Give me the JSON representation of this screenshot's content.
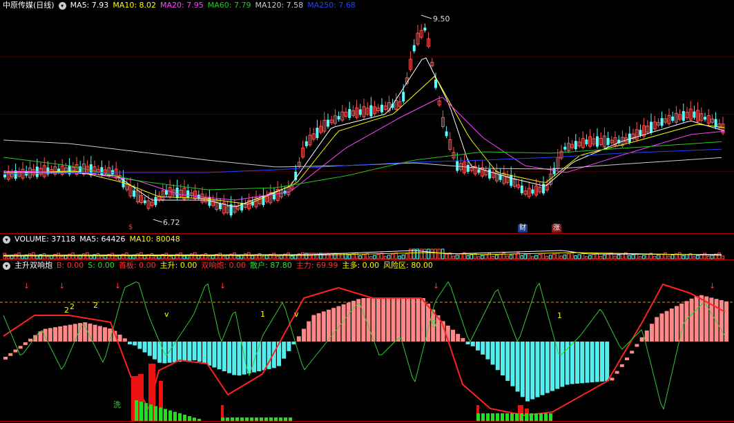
{
  "main": {
    "title": "中原传媒(日线)",
    "ma": [
      {
        "label": "MA5: 7.93",
        "color": "#ffffff"
      },
      {
        "label": "MA10: 8.02",
        "color": "#ffff00"
      },
      {
        "label": "MA20: 7.95",
        "color": "#ff44ff"
      },
      {
        "label": "MA60: 7.79",
        "color": "#22cc22"
      },
      {
        "label": "MA120: 7.58",
        "color": "#cccccc"
      },
      {
        "label": "MA250: 7.68",
        "color": "#2244ff"
      }
    ],
    "high_label": "9.50",
    "low_label": "6.72",
    "tag_s": "$",
    "tag_cai": "财",
    "tag_zhang": "涨"
  },
  "volume": {
    "labels": [
      {
        "label": "VOLUME: 37118",
        "color": "#ffffff"
      },
      {
        "label": "MA5: 64426",
        "color": "#ffffff"
      },
      {
        "label": "MA10: 80048",
        "color": "#ffff00"
      }
    ]
  },
  "indicator": {
    "name": "主升双响炮",
    "items": [
      {
        "label": "B: 0.00",
        "color": "#ff3333"
      },
      {
        "label": "S: 0.00",
        "color": "#33dd33"
      },
      {
        "label": "首板: 0.00",
        "color": "#ff3333"
      },
      {
        "label": "主升: 0.00",
        "color": "#ffff00"
      },
      {
        "label": "双响炮: 0.00",
        "color": "#ff3333"
      },
      {
        "label": "散户: 87.80",
        "color": "#33dd33"
      },
      {
        "label": "主力: 69.99",
        "color": "#ff3333"
      },
      {
        "label": "主多: 0.00",
        "color": "#ffff00"
      },
      {
        "label": "风险区: 80.00",
        "color": "#ffff00"
      }
    ],
    "marks": {
      "two_a": "2",
      "two_b": "2",
      "two_c": "2",
      "v_a": "v",
      "one_a": "1",
      "v_b": "v",
      "s_a": "S",
      "one_b": "1",
      "wash": "洗",
      "arrow": "↓"
    }
  },
  "colors": {
    "up": "#ff5555",
    "down": "#55ffff",
    "sep": "#b00000"
  }
}
